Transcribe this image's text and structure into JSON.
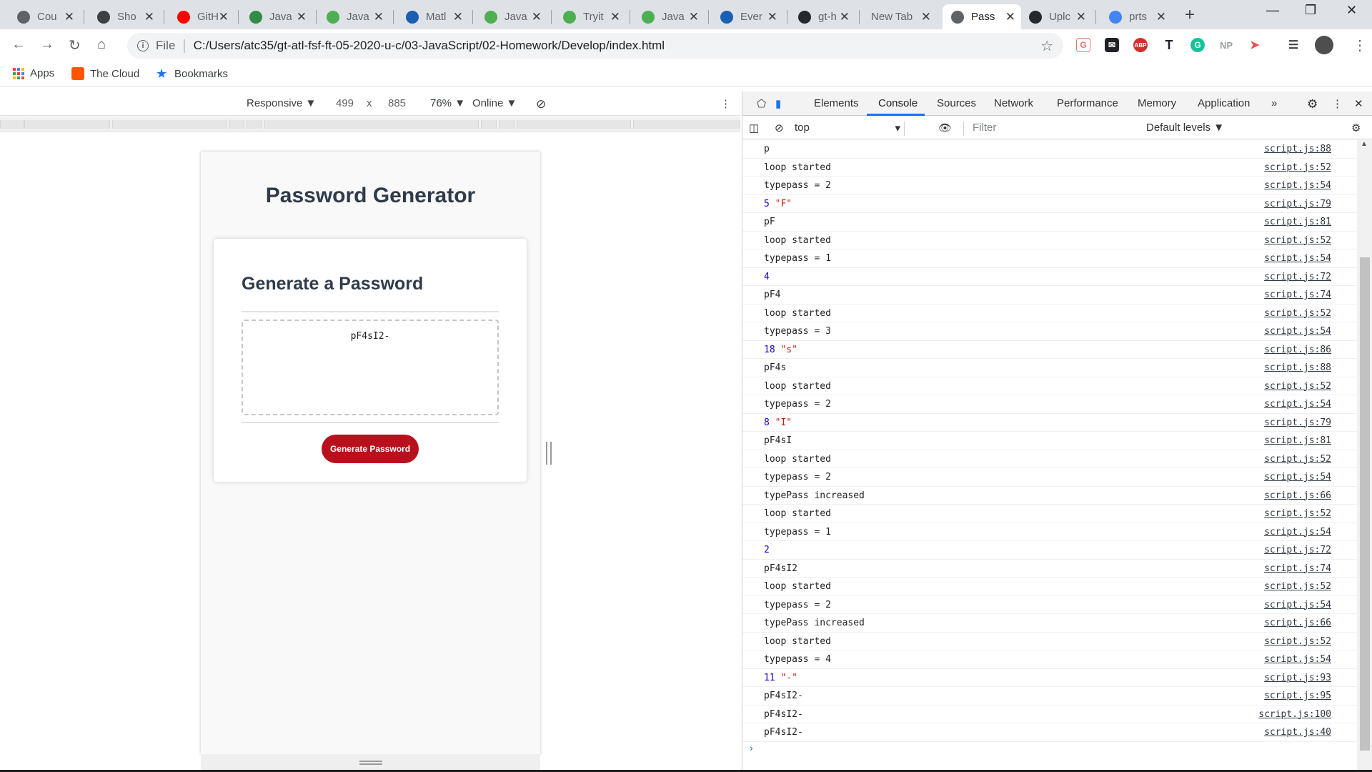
{
  "tabs": [
    {
      "title": "Cou",
      "color": "#5f6368"
    },
    {
      "title": "Sho",
      "color": "#3c4043"
    },
    {
      "title": "GitH",
      "color": "#ff0000"
    },
    {
      "title": "Java",
      "color": "#2f8d46"
    },
    {
      "title": "Java",
      "color": "#4caf50"
    },
    {
      "title": "Matl",
      "color": "#1a5fb4"
    },
    {
      "title": "Java",
      "color": "#4caf50"
    },
    {
      "title": "Tryit",
      "color": "#4caf50"
    },
    {
      "title": "Java",
      "color": "#4caf50"
    },
    {
      "title": "Ever",
      "color": "#1a5fb4"
    },
    {
      "title": "gt-h",
      "color": "#24292e"
    },
    {
      "title": "New Tab",
      "color": ""
    },
    {
      "title": "Pass",
      "color": "#5f6368"
    },
    {
      "title": "Uplc",
      "color": "#24292e"
    },
    {
      "title": "prts",
      "color": "#4285f4"
    }
  ],
  "addressbar": {
    "scheme_label": "File",
    "url": "C:/Users/atc35/gt-atl-fsf-ft-05-2020-u-c/03-JavaScript/02-Homework/Develop/index.html"
  },
  "bookmarks": [
    {
      "label": "Apps"
    },
    {
      "label": "The Cloud"
    },
    {
      "label": "Bookmarks"
    }
  ],
  "device_toolbar": {
    "mode": "Responsive ▼",
    "width": "499",
    "times": "x",
    "height": "885",
    "zoom": "76% ▼",
    "network": "Online ▼"
  },
  "page": {
    "heading": "Password Generator",
    "card_title": "Generate a Password",
    "password": "pF4sI2-",
    "button_label": "Generate Password"
  },
  "devtools": {
    "tabs": [
      "Elements",
      "Console",
      "Sources",
      "Network",
      "Performance",
      "Memory",
      "Application",
      "»"
    ],
    "active_tab": "Console",
    "context": "top",
    "filter_placeholder": "Filter",
    "levels": "Default levels ▼"
  },
  "console_rows": [
    {
      "msg": "p",
      "src": "script.js:88"
    },
    {
      "msg": "loop started",
      "src": "script.js:52"
    },
    {
      "msg": "typepass = 2",
      "src": "script.js:54"
    },
    {
      "num": "5",
      "str": "\"F\"",
      "src": "script.js:79"
    },
    {
      "msg": "pF",
      "src": "script.js:81"
    },
    {
      "msg": "loop started",
      "src": "script.js:52"
    },
    {
      "msg": "typepass = 1",
      "src": "script.js:54"
    },
    {
      "num": "4",
      "src": "script.js:72"
    },
    {
      "msg": "pF4",
      "src": "script.js:74"
    },
    {
      "msg": "loop started",
      "src": "script.js:52"
    },
    {
      "msg": "typepass = 3",
      "src": "script.js:54"
    },
    {
      "num": "18",
      "str": "\"s\"",
      "src": "script.js:86"
    },
    {
      "msg": "pF4s",
      "src": "script.js:88"
    },
    {
      "msg": "loop started",
      "src": "script.js:52"
    },
    {
      "msg": "typepass = 2",
      "src": "script.js:54"
    },
    {
      "num": "8",
      "str": "\"I\"",
      "src": "script.js:79"
    },
    {
      "msg": "pF4sI",
      "src": "script.js:81"
    },
    {
      "msg": "loop started",
      "src": "script.js:52"
    },
    {
      "msg": "typepass = 2",
      "src": "script.js:54"
    },
    {
      "msg": "typePass increased",
      "src": "script.js:66"
    },
    {
      "msg": "loop started",
      "src": "script.js:52"
    },
    {
      "msg": "typepass = 1",
      "src": "script.js:54"
    },
    {
      "num": "2",
      "src": "script.js:72"
    },
    {
      "msg": "pF4sI2",
      "src": "script.js:74"
    },
    {
      "msg": "loop started",
      "src": "script.js:52"
    },
    {
      "msg": "typepass = 2",
      "src": "script.js:54"
    },
    {
      "msg": "typePass increased",
      "src": "script.js:66"
    },
    {
      "msg": "loop started",
      "src": "script.js:52"
    },
    {
      "msg": "typepass = 4",
      "src": "script.js:54"
    },
    {
      "num": "11",
      "str": "\"-\"",
      "src": "script.js:93"
    },
    {
      "msg": "pF4sI2-",
      "src": "script.js:95"
    },
    {
      "msg": "pF4sI2-",
      "src": "script.js:100"
    },
    {
      "msg": "pF4sI2-",
      "src": "script.js:40"
    }
  ],
  "console_prompt": "›"
}
